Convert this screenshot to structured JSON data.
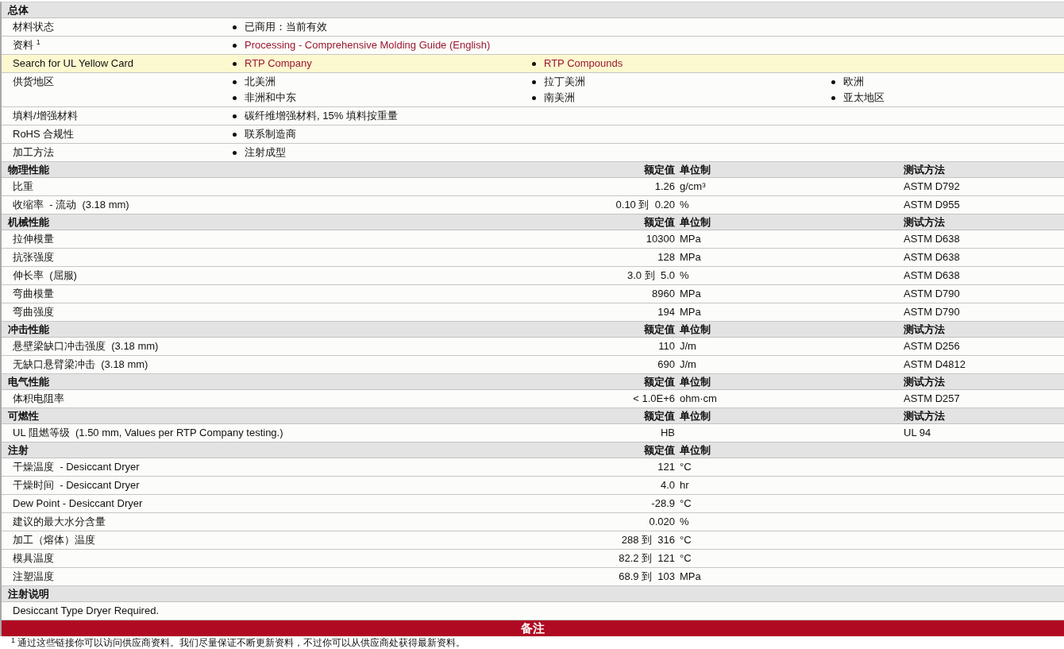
{
  "sections": [
    {
      "kind": "general",
      "title": "总体",
      "rows": [
        {
          "label": "材料状态",
          "highlighted": false,
          "items": [
            {
              "text": "已商用：当前有效",
              "link": false
            }
          ]
        },
        {
          "label": "资料 $^{1}$",
          "highlighted": false,
          "items": [
            {
              "text": "Processing - Comprehensive Molding Guide (English)",
              "link": true
            }
          ]
        },
        {
          "label": "Search for UL Yellow Card",
          "highlighted": true,
          "items": [
            {
              "text": "RTP Company",
              "link": true
            },
            {
              "text": "RTP Compounds",
              "link": true
            }
          ]
        },
        {
          "label": "供货地区",
          "highlighted": false,
          "items": [
            {
              "text": "北美洲",
              "link": false
            },
            {
              "text": "拉丁美洲",
              "link": false
            },
            {
              "text": "欧洲",
              "link": false
            },
            {
              "text": "非洲和中东",
              "link": false
            },
            {
              "text": "南美洲",
              "link": false
            },
            {
              "text": "亚太地区",
              "link": false
            }
          ]
        },
        {
          "label": "填料/增强材料",
          "highlighted": false,
          "items": [
            {
              "text": "碳纤维增强材料, 15% 填料按重量",
              "link": false
            }
          ]
        },
        {
          "label": "RoHS 合规性",
          "highlighted": false,
          "items": [
            {
              "text": "联系制造商",
              "link": false
            }
          ]
        },
        {
          "label": "加工方法",
          "highlighted": false,
          "items": [
            {
              "text": "注射成型",
              "link": false
            }
          ]
        }
      ]
    },
    {
      "kind": "properties",
      "title": "物理性能",
      "headers": {
        "value": "额定值",
        "unit": "单位制",
        "method": "测试方法"
      },
      "rows": [
        {
          "label": "比重",
          "value": "1.26",
          "unit": "g/cm³",
          "method": "ASTM D792"
        },
        {
          "label": "收缩率  - 流动  (3.18 mm)",
          "value": "0.10 到  0.20",
          "unit": "%",
          "method": "ASTM D955"
        }
      ]
    },
    {
      "kind": "properties",
      "title": "机械性能",
      "headers": {
        "value": "额定值",
        "unit": "单位制",
        "method": "测试方法"
      },
      "rows": [
        {
          "label": "拉伸模量",
          "value": "10300",
          "unit": "MPa",
          "method": "ASTM D638"
        },
        {
          "label": "抗张强度",
          "value": "128",
          "unit": "MPa",
          "method": "ASTM D638"
        },
        {
          "label": "伸长率  (屈服)",
          "value": "3.0 到  5.0",
          "unit": "%",
          "method": "ASTM D638"
        },
        {
          "label": "弯曲模量",
          "value": "8960",
          "unit": "MPa",
          "method": "ASTM D790"
        },
        {
          "label": "弯曲强度",
          "value": "194",
          "unit": "MPa",
          "method": "ASTM D790"
        }
      ]
    },
    {
      "kind": "properties",
      "title": "冲击性能",
      "headers": {
        "value": "额定值",
        "unit": "单位制",
        "method": "测试方法"
      },
      "rows": [
        {
          "label": "悬壁梁缺口冲击强度  (3.18 mm)",
          "value": "110",
          "unit": "J/m",
          "method": "ASTM D256"
        },
        {
          "label": "无缺口悬臂梁冲击  (3.18 mm)",
          "value": "690",
          "unit": "J/m",
          "method": "ASTM D4812"
        }
      ]
    },
    {
      "kind": "properties",
      "title": "电气性能",
      "headers": {
        "value": "额定值",
        "unit": "单位制",
        "method": "测试方法"
      },
      "rows": [
        {
          "label": "体积电阻率",
          "value": "< 1.0E+6",
          "unit": "ohm·cm",
          "method": "ASTM D257"
        }
      ]
    },
    {
      "kind": "properties",
      "title": "可燃性",
      "headers": {
        "value": "额定值",
        "unit": "单位制",
        "method": "测试方法"
      },
      "rows": [
        {
          "label": "UL 阻燃等级  (1.50 mm, Values per RTP Company testing.)",
          "value": "HB",
          "method": "UL 94"
        }
      ]
    },
    {
      "kind": "properties",
      "title": "注射",
      "headers": {
        "value": "额定值",
        "unit": "单位制"
      },
      "rows": [
        {
          "label": "干燥温度  - Desiccant Dryer",
          "value": "121",
          "unit": "°C"
        },
        {
          "label": "干燥时间  - Desiccant Dryer",
          "value": "4.0",
          "unit": "hr"
        },
        {
          "label": "Dew Point - Desiccant Dryer",
          "value": "-28.9",
          "unit": "°C"
        },
        {
          "label": "建议的最大水分含量",
          "value": "0.020",
          "unit": "%"
        },
        {
          "label": "加工（熔体）温度",
          "value": "288 到  316",
          "unit": "°C"
        },
        {
          "label": "模具温度",
          "value": "82.2 到  121",
          "unit": "°C"
        },
        {
          "label": "注塑温度",
          "value": "68.9 到  103",
          "unit": "MPa"
        }
      ]
    },
    {
      "kind": "notes",
      "title": "注射说明",
      "lines": [
        "Desiccant Type Dryer Required."
      ]
    }
  ],
  "remarks": {
    "title": "备注",
    "footnotes": [
      "$^{1}$ 通过这些链接你可以访问供应商资料。我们尽量保证不断更新资料，不过你可以从供应商处获得最新资料。"
    ]
  }
}
